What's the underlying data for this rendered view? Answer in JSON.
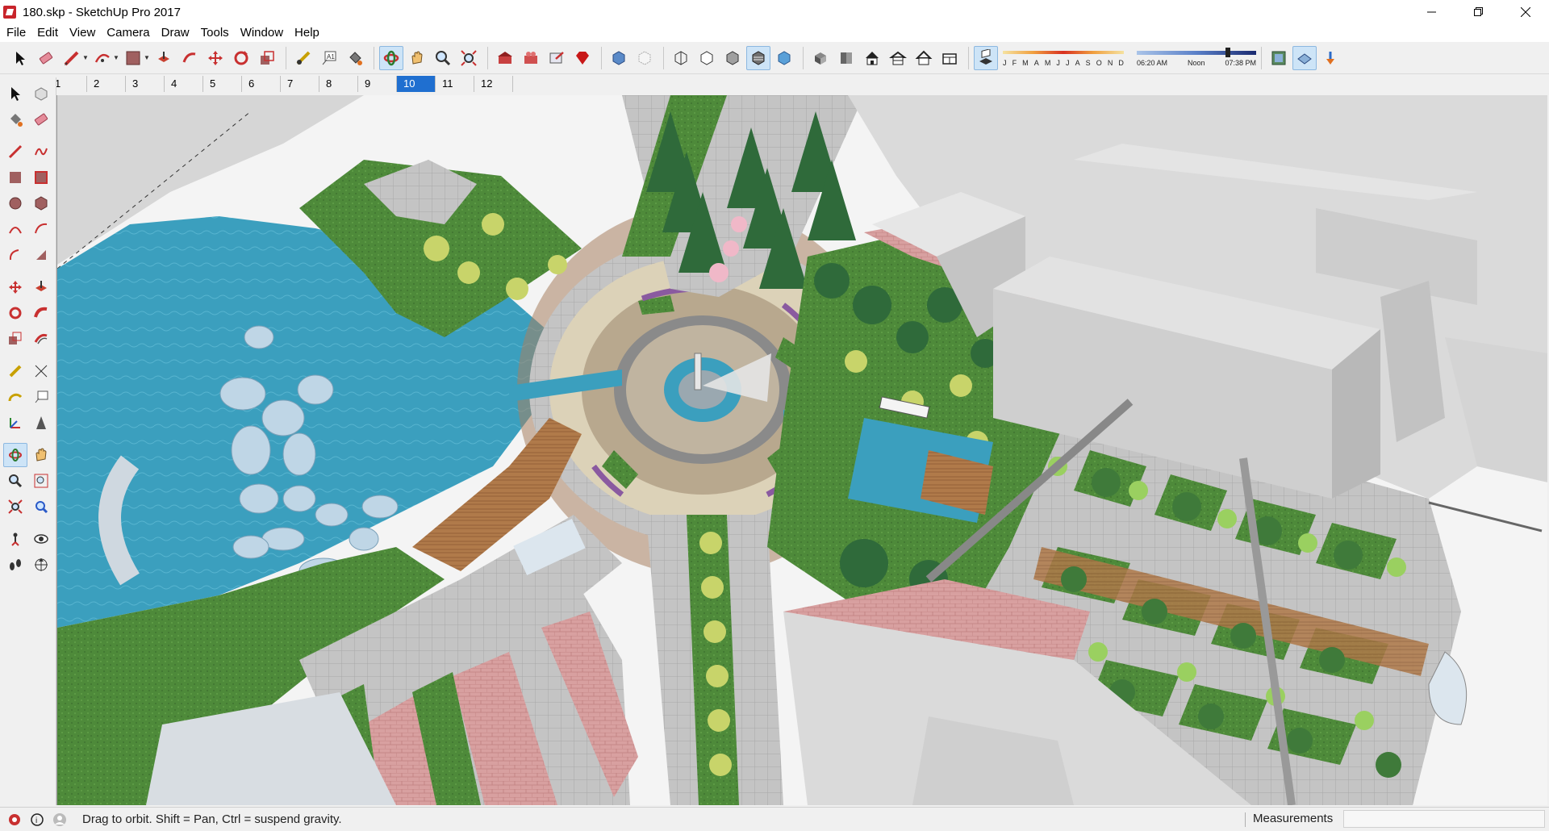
{
  "window": {
    "title": "180.skp - SketchUp Pro 2017",
    "controls": [
      "minimize",
      "restore",
      "close"
    ]
  },
  "menu": [
    "File",
    "Edit",
    "View",
    "Camera",
    "Draw",
    "Tools",
    "Window",
    "Help"
  ],
  "toolbar": {
    "icons": [
      "select-icon",
      "eraser-icon",
      "pencil-icon",
      "freehand-icon",
      "rectangle-icon",
      "pushpull-icon",
      "follow-me-icon",
      "move-icon",
      "rotate-icon",
      "scale-icon",
      "tape-measure-icon",
      "text-icon",
      "paint-bucket-icon",
      "orbit-icon",
      "pan-icon",
      "zoom-icon",
      "zoom-extents-icon",
      "warehouse-icon",
      "extension-icon",
      "share-icon",
      "ruby-icon",
      "xray-icon",
      "back-edges-icon",
      "wireframe-icon",
      "hidden-line-icon",
      "shaded-icon",
      "shaded-textures-icon",
      "monochrome-icon",
      "iso-icon",
      "top-icon",
      "front-icon",
      "right-icon",
      "back-icon",
      "left-icon",
      "shadows-toggle-icon",
      "geolocation-icon",
      "fog-icon",
      "sandbox-icon"
    ],
    "shadow": {
      "months": [
        "J",
        "F",
        "M",
        "A",
        "M",
        "J",
        "J",
        "A",
        "S",
        "O",
        "N",
        "D"
      ],
      "time_start": "06:20 AM",
      "time_mid": "Noon",
      "time_end": "07:38 PM"
    }
  },
  "scenes": {
    "tabs": [
      "1",
      "2",
      "3",
      "4",
      "5",
      "6",
      "7",
      "8",
      "9",
      "10",
      "11",
      "12"
    ],
    "active": "10"
  },
  "status": {
    "hint": "Drag to orbit. Shift = Pan, Ctrl = suspend gravity.",
    "measurements_label": "Measurements",
    "measurements_value": ""
  },
  "colors": {
    "water": "#3a9dbd",
    "grass": "#4f8c3a",
    "paving": "#bfbfbf",
    "brick": "#d9a0a0",
    "building": "#d2d2d2",
    "active_tab": "#1f6fd0"
  }
}
